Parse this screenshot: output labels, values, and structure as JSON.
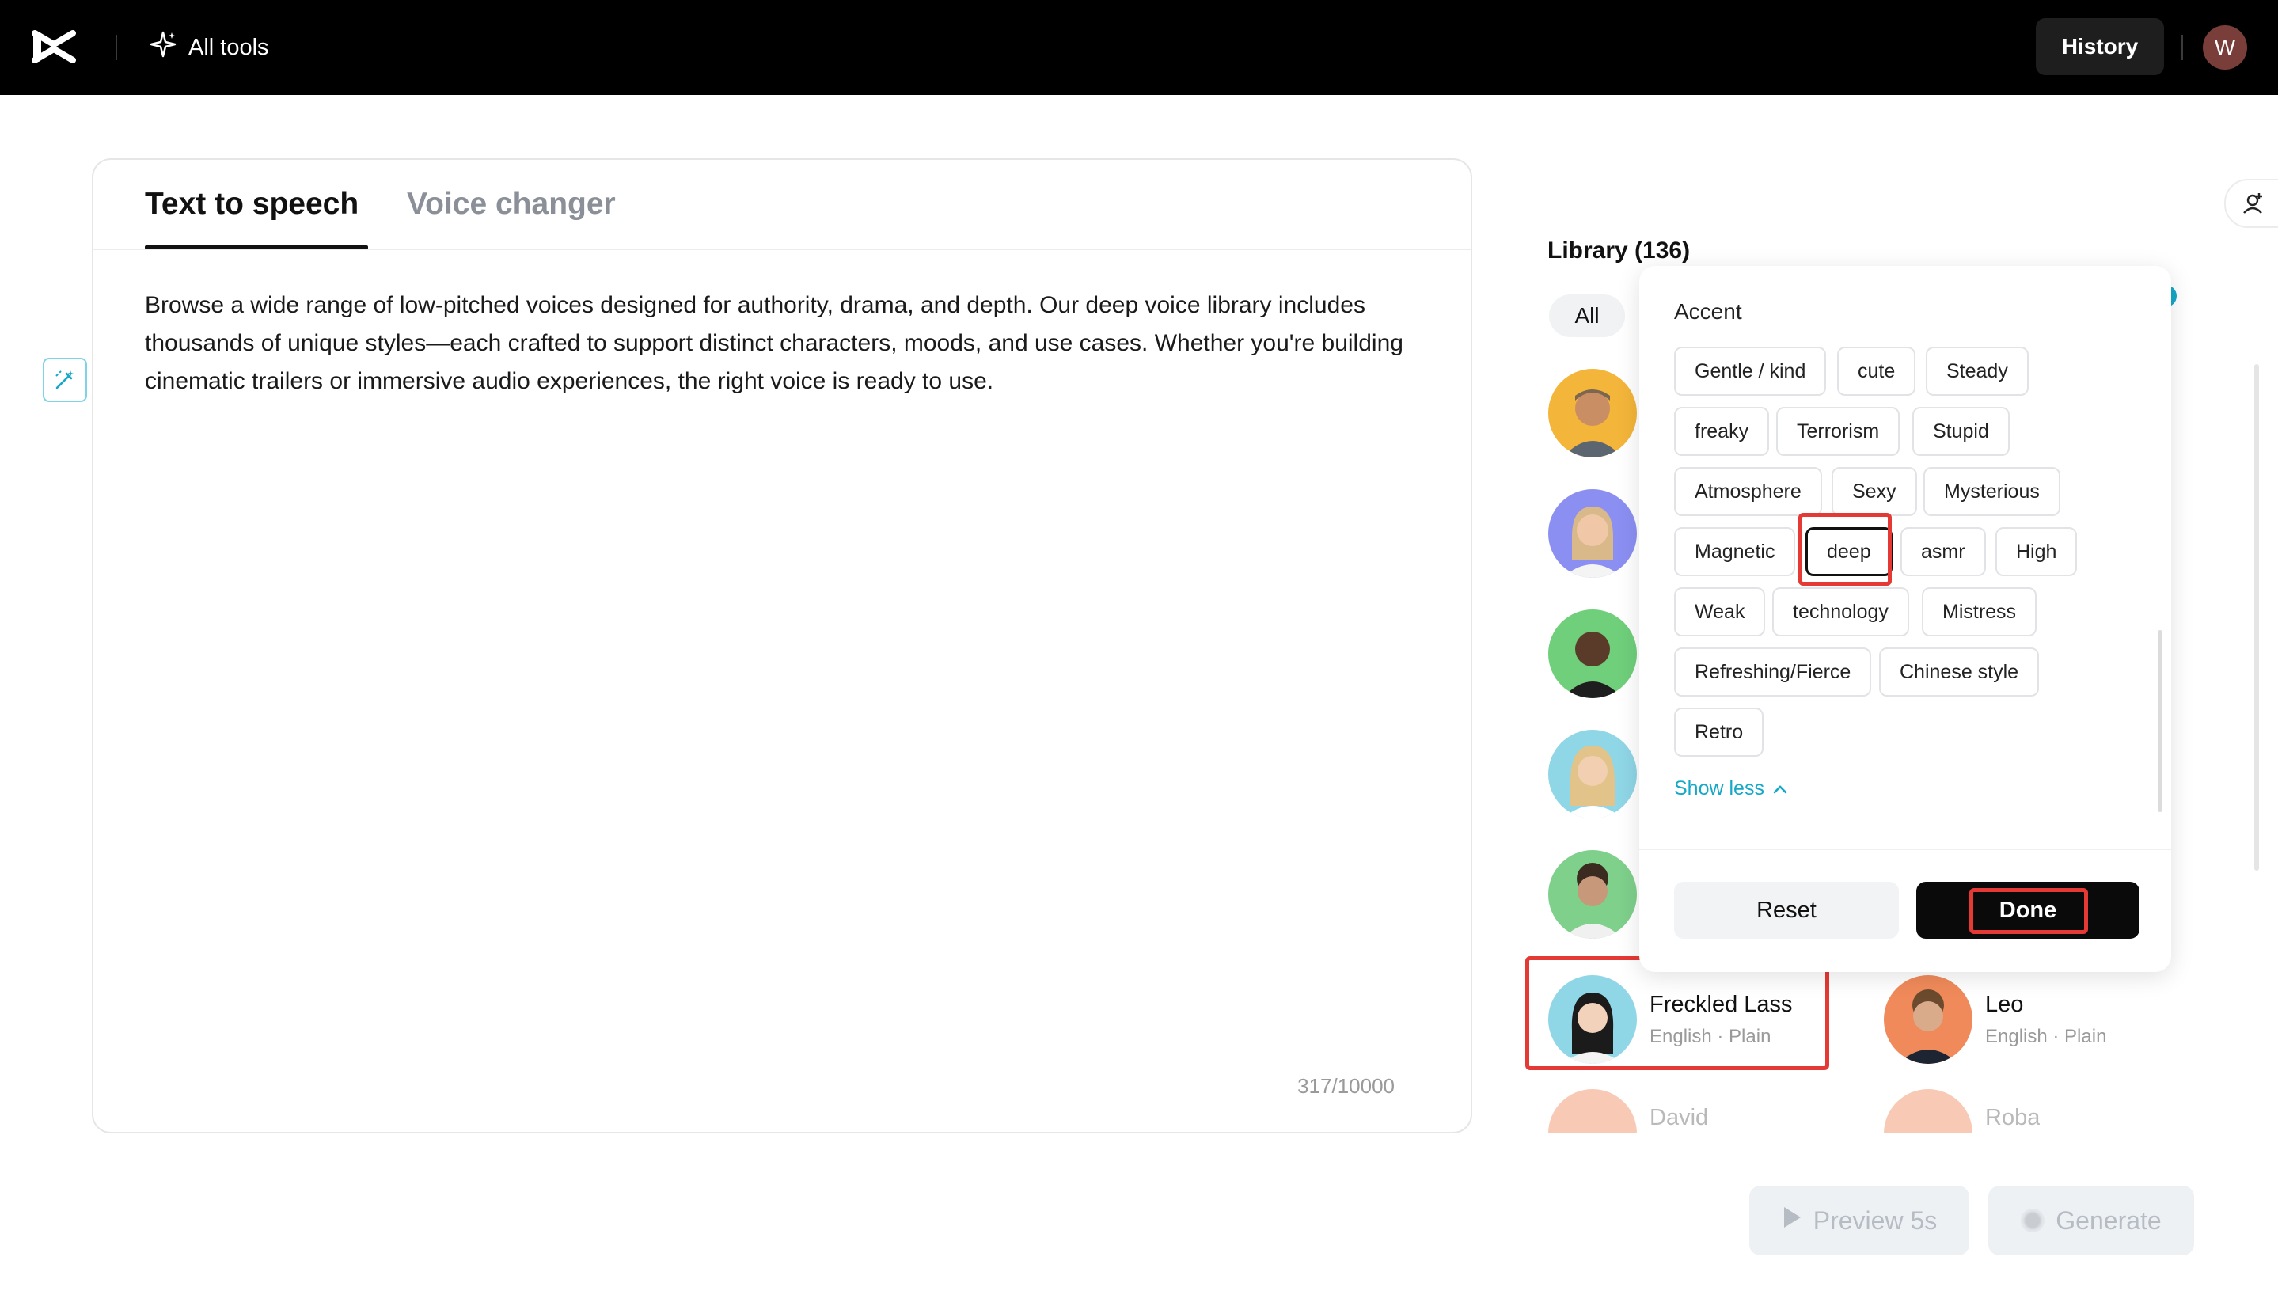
{
  "topbar": {
    "all_tools_label": "All tools",
    "history_label": "History",
    "user_initial": "W"
  },
  "editor": {
    "tabs": [
      {
        "label": "Text to speech",
        "active": true
      },
      {
        "label": "Voice changer",
        "active": false
      }
    ],
    "text": "Browse a wide range of low-pitched voices designed for authority, drama, and depth. Our deep voice library includes thousands of unique styles—each crafted to support distinct characters, moods, and use cases. Whether you're building cinematic trailers or immersive audio experiences, the right voice is ready to use.",
    "counter": "317/10000"
  },
  "library": {
    "title": "Library (136)",
    "filter_all": "All",
    "voices": [
      {
        "name": "Freckled Lass",
        "meta": "English · Plain"
      },
      {
        "name": "Leo",
        "meta": "English · Plain"
      },
      {
        "name": "David",
        "meta": ""
      },
      {
        "name": "Roba",
        "meta": ""
      }
    ]
  },
  "filter_popover": {
    "heading": "Accent",
    "tags": [
      "Gentle / kind",
      "cute",
      "Steady",
      "freaky",
      "Terrorism",
      "Stupid",
      "Atmosphere",
      "Sexy",
      "Mysterious",
      "Magnetic",
      "deep",
      "asmr",
      "High",
      "Weak",
      "technology",
      "Mistress",
      "Refreshing/Fierce",
      "Chinese style",
      "Retro"
    ],
    "selected_tag": "deep",
    "show_less_label": "Show less",
    "reset_label": "Reset",
    "done_label": "Done"
  },
  "actions": {
    "preview_label": "Preview 5s",
    "generate_label": "Generate"
  },
  "colors": {
    "topbar": "#000000",
    "accent_link": "#15a8c7",
    "highlight": "#e53935",
    "done_button": "#0a0a0a"
  }
}
